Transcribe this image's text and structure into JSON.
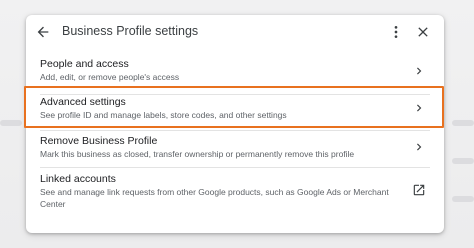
{
  "header": {
    "title": "Business Profile settings"
  },
  "rows": [
    {
      "title": "People and access",
      "description": "Add, edit, or remove people's access",
      "action": "chevron-right-icon"
    },
    {
      "title": "Advanced settings",
      "description": "See profile ID and manage labels, store codes, and other settings",
      "action": "chevron-right-icon",
      "highlighted": true
    },
    {
      "title": "Remove Business Profile",
      "description": "Mark this business as closed, transfer ownership or permanently remove this profile",
      "action": "chevron-right-icon"
    },
    {
      "title": "Linked accounts",
      "description": "See and manage link requests from other Google products, such as Google Ads or Merchant Center",
      "action": "open-in-new-icon"
    }
  ],
  "colors": {
    "highlight": "#e8711f",
    "title_text": "#202124",
    "secondary_text": "#5f6368"
  }
}
